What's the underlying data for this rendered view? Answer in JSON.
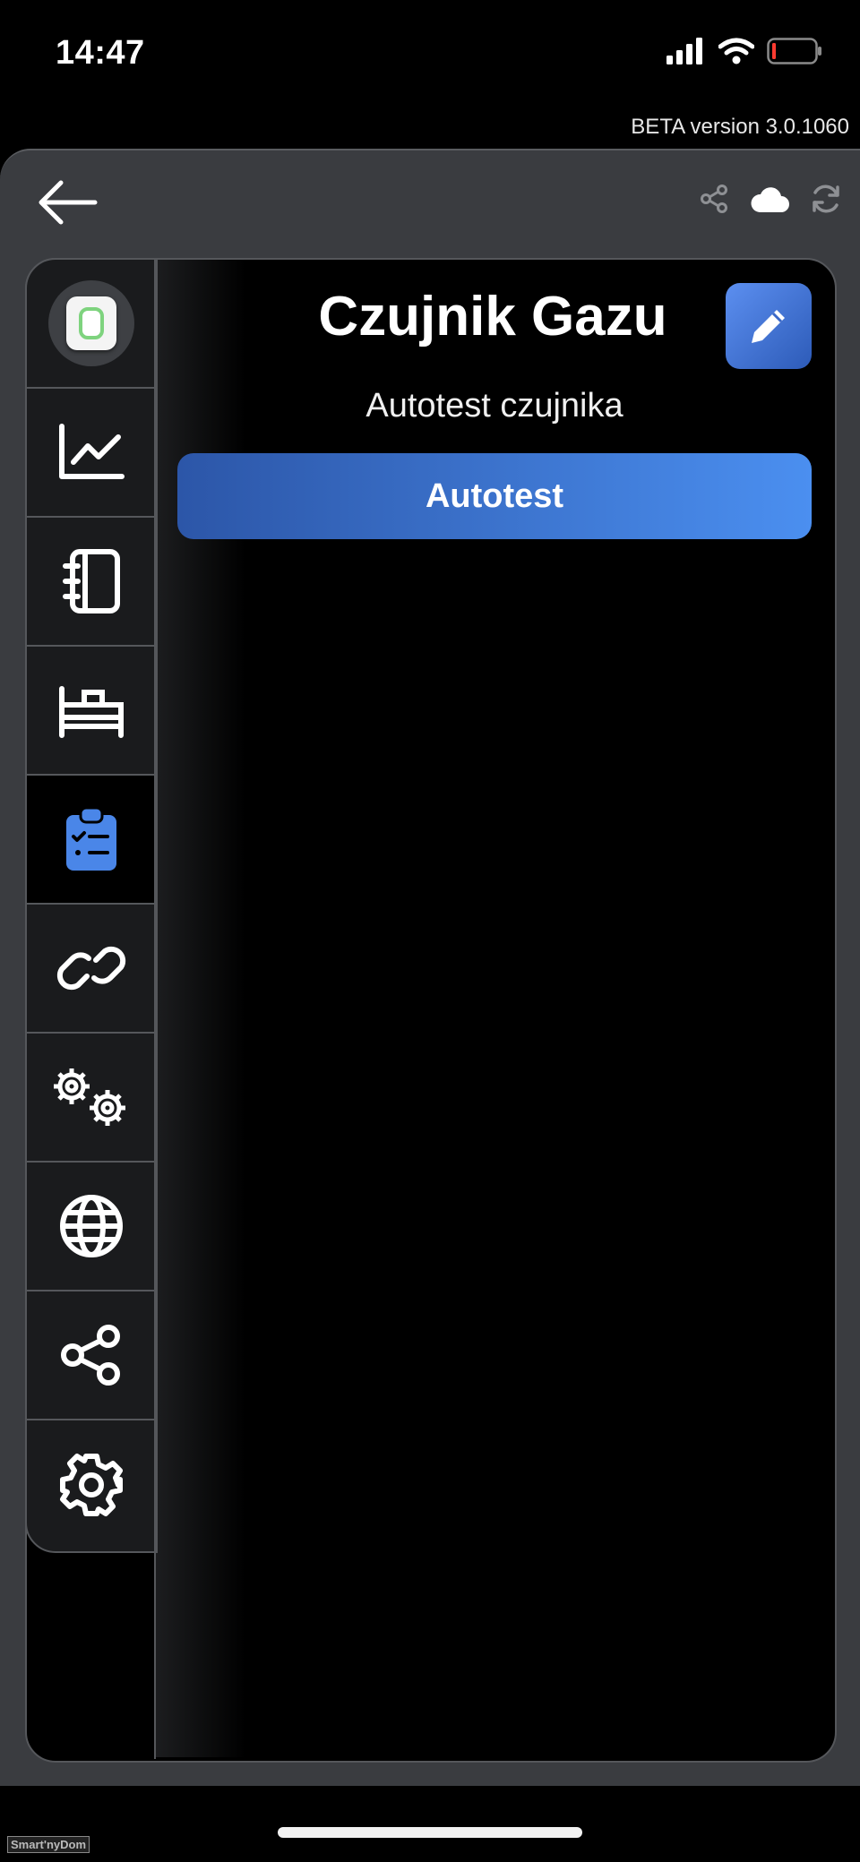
{
  "status_bar": {
    "time": "14:47"
  },
  "beta_label": "BETA version 3.0.1060",
  "header": {
    "back_icon": "arrow-left-icon",
    "actions": [
      "share-icon",
      "cloud-icon",
      "refresh-icon"
    ]
  },
  "device": {
    "title": "Czujnik Gazu"
  },
  "sidebar": {
    "tabs": [
      {
        "icon": "device-thumbnail",
        "active": false
      },
      {
        "icon": "chart-line-icon",
        "active": false
      },
      {
        "icon": "notebook-icon",
        "active": false
      },
      {
        "icon": "bed-icon",
        "active": false
      },
      {
        "icon": "clipboard-checklist-icon",
        "active": true
      },
      {
        "icon": "link-icon",
        "active": false
      },
      {
        "icon": "gears-icon",
        "active": false
      },
      {
        "icon": "globe-icon",
        "active": false
      },
      {
        "icon": "share-nodes-icon",
        "active": false
      },
      {
        "icon": "settings-gear-icon",
        "active": false
      }
    ]
  },
  "main": {
    "section_label": "Autotest czujnika",
    "autotest_button": "Autotest"
  },
  "colors": {
    "accent": "#4a86e8",
    "frame": "#3a3c40",
    "border": "#55575b"
  },
  "watermark": "Smart'nyDom"
}
